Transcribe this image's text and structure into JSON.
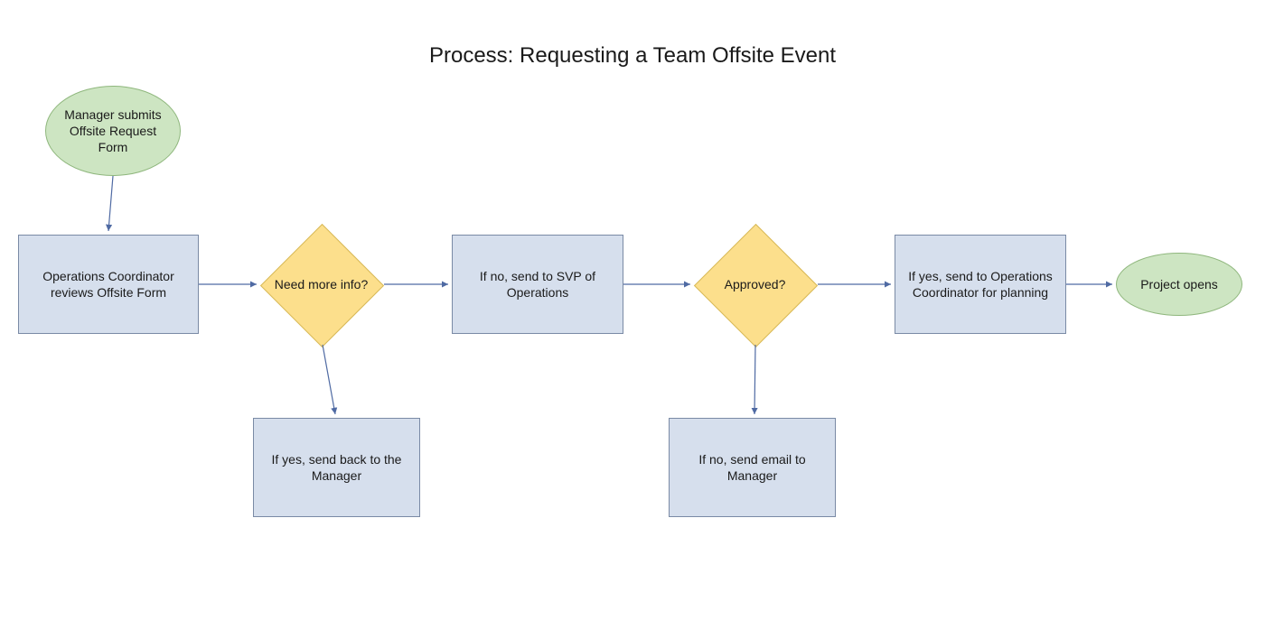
{
  "title": "Process: Requesting a Team Offsite Event",
  "nodes": {
    "start": "Manager submits Offsite Request Form",
    "review": "Operations Coordinator reviews Offsite Form",
    "need_info": "Need more info?",
    "yes_back": "If yes, send back to the Manager",
    "no_svp": "If no, send to SVP of Operations",
    "approved": "Approved?",
    "no_email": "If no, send email to Manager",
    "yes_plan": "If yes, send to Operations Coordinator for planning",
    "end": "Project opens"
  },
  "colors": {
    "rect_fill": "#d6dfed",
    "rect_stroke": "#7a8aa5",
    "ellipse_fill": "#cde5c2",
    "ellipse_stroke": "#8fb77d",
    "diamond_fill": "#fcdf8c",
    "diamond_stroke": "#d7b95a",
    "arrow": "#4f6aa3"
  }
}
